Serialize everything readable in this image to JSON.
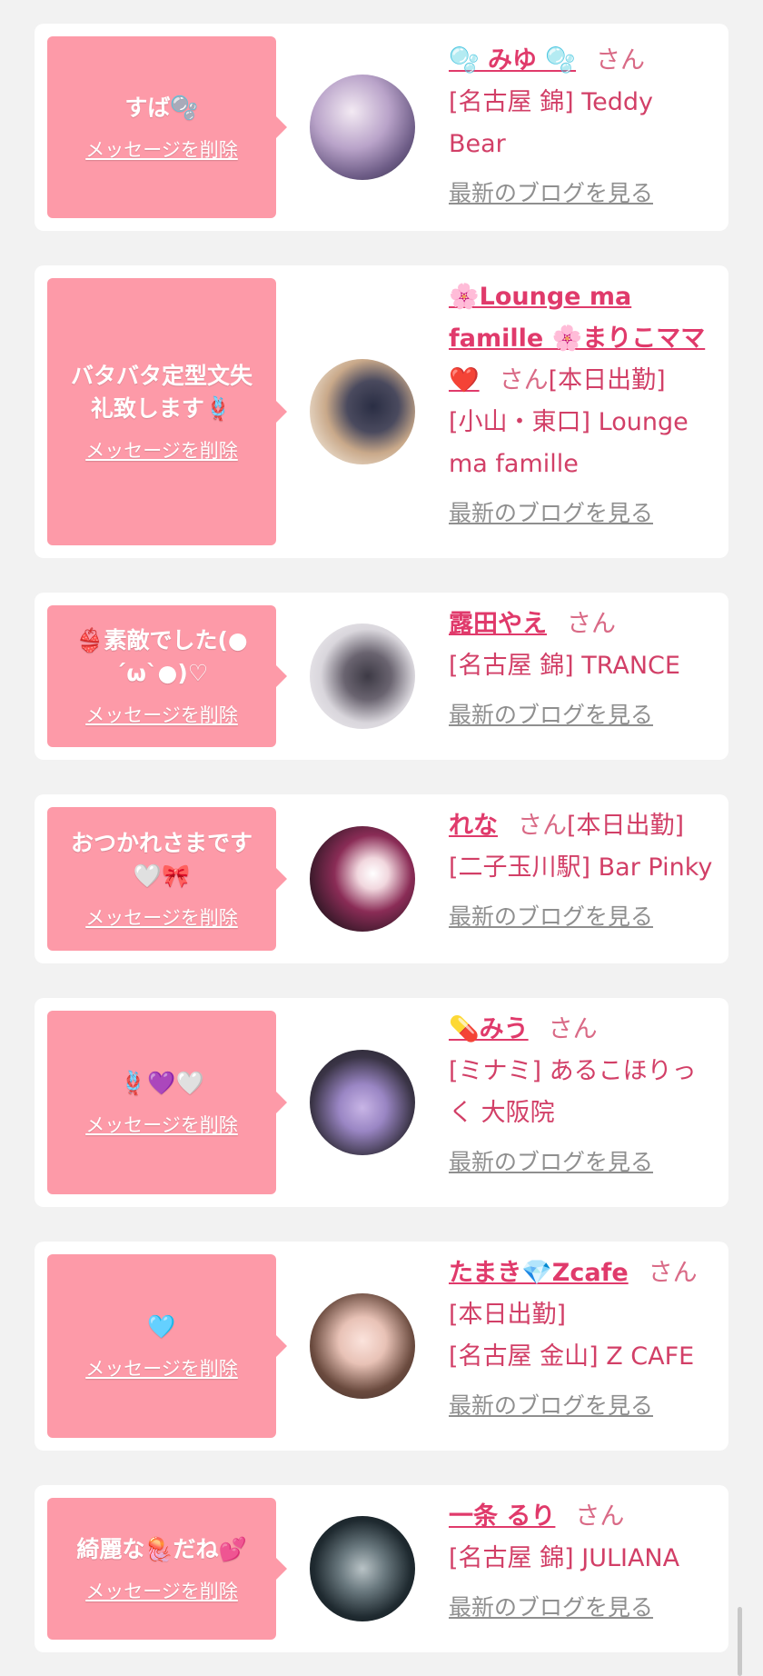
{
  "delete_label": "メッセージを削除",
  "blog_label": "最新のブログを見る",
  "san_label": "さん",
  "colors": {
    "bubble": "#fd9aa8",
    "name": "#e03a6b",
    "text": "#d23f67",
    "link_gray": "#8f8f8f",
    "background": "#f2f2f2"
  },
  "cards": [
    {
      "message": "すば🫧",
      "name": "🫧 みゆ 🫧",
      "after_name": "",
      "shop": "[名古屋 錦] Teddy Bear",
      "avatar_icon": "person-avatar"
    },
    {
      "message": "バタバタ定型文失礼致します🪢",
      "name": "🌸Lounge ma famille 🌸まりこママ❤️",
      "after_name": "[本日出勤]",
      "shop": "[小山・東口] Lounge ma famille",
      "avatar_icon": "person-avatar"
    },
    {
      "message": "👙素敵でした(●´ω`●)♡",
      "name": "露田やえ",
      "after_name": "",
      "shop": "[名古屋 錦] TRANCE",
      "avatar_icon": "person-avatar"
    },
    {
      "message": "おつかれさまです🤍🎀",
      "name": "れな",
      "after_name": "[本日出勤]",
      "shop": "[二子玉川駅] Bar Pinky",
      "avatar_icon": "person-avatar"
    },
    {
      "message": "🪢💜🤍",
      "name": "💊みう",
      "after_name": "",
      "shop": "[ミナミ] あるこほりっく 大阪院",
      "avatar_icon": "person-avatar"
    },
    {
      "message": "🩵",
      "name": "たまき💎Zcafe",
      "after_name": "[本日出勤]",
      "shop": "[名古屋 金山] Z CAFE",
      "avatar_icon": "person-avatar"
    },
    {
      "message": "綺麗な🪼だね💕",
      "name": "一条 るり",
      "after_name": "",
      "shop": "[名古屋 錦] JULIANA",
      "avatar_icon": "person-avatar"
    }
  ]
}
